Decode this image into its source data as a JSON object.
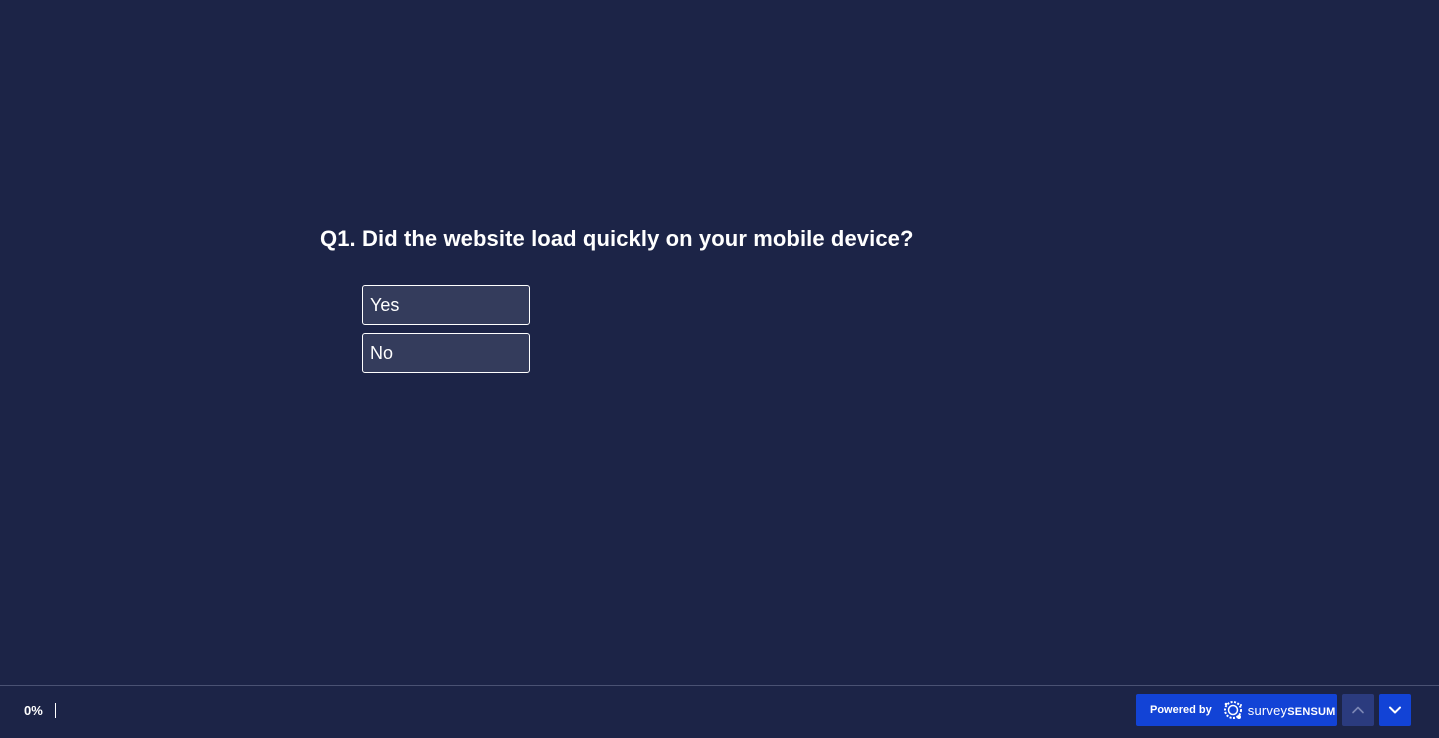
{
  "question": {
    "number": "Q1.",
    "text": "Did the website load quickly on your mobile device?",
    "options": [
      {
        "label": "Yes"
      },
      {
        "label": "No"
      }
    ]
  },
  "footer": {
    "progress_text": "0%",
    "progress_value": 0,
    "powered_by_label": "Powered by",
    "brand_light": "survey",
    "brand_bold": "SENSUM",
    "nav_up_icon": "chevron-up-icon",
    "nav_down_icon": "chevron-down-icon"
  },
  "colors": {
    "background": "#1c2447",
    "option_background": "#343c5c",
    "accent": "#1243d6",
    "nav_up_disabled": "#2b3b7e"
  }
}
